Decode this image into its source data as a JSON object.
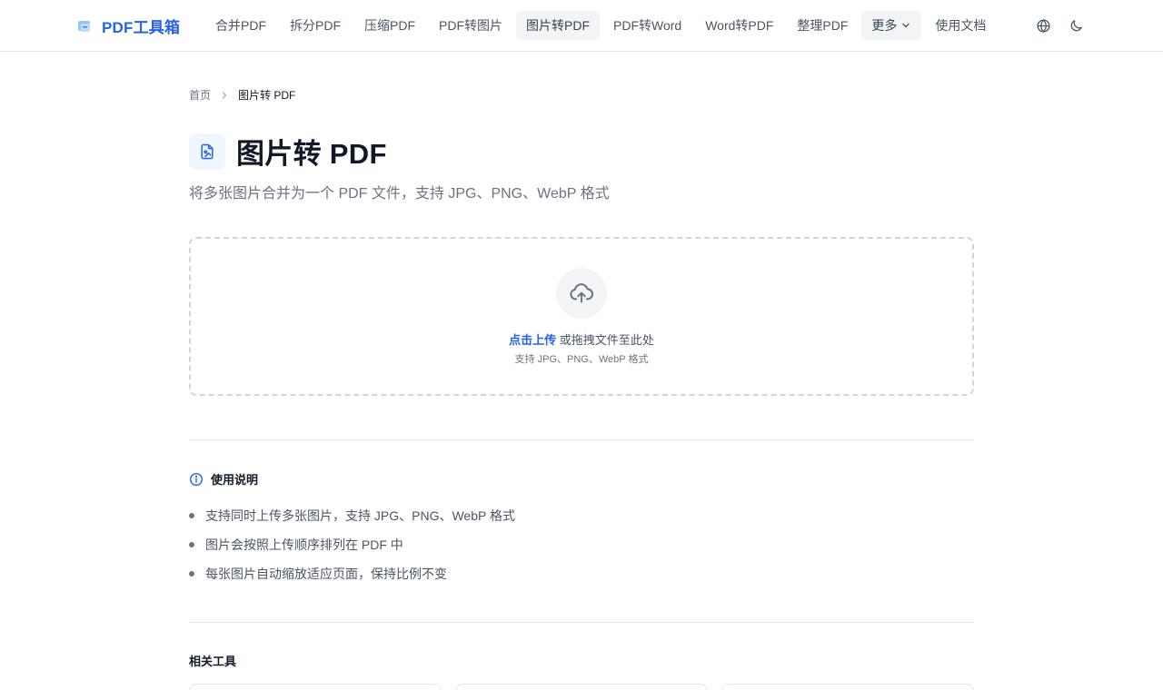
{
  "header": {
    "brand_name": "PDF工具箱",
    "nav": [
      {
        "label": "合并PDF",
        "active": false
      },
      {
        "label": "拆分PDF",
        "active": false
      },
      {
        "label": "压缩PDF",
        "active": false
      },
      {
        "label": "PDF转图片",
        "active": false
      },
      {
        "label": "图片转PDF",
        "active": true
      },
      {
        "label": "PDF转Word",
        "active": false
      },
      {
        "label": "Word转PDF",
        "active": false
      },
      {
        "label": "整理PDF",
        "active": false
      }
    ],
    "more_label": "更多",
    "docs_label": "使用文档",
    "icons": [
      "globe-icon",
      "moon-icon"
    ]
  },
  "breadcrumb": {
    "home": "首页",
    "current": "图片转 PDF"
  },
  "page": {
    "title": "图片转 PDF",
    "subtitle": "将多张图片合并为一个 PDF 文件，支持 JPG、PNG、WebP 格式"
  },
  "upload": {
    "link_text": "点击上传",
    "rest_text": " 或拖拽文件至此处",
    "hint": "支持 JPG、PNG、WebP 格式"
  },
  "instructions": {
    "title": "使用说明",
    "items": [
      "支持同时上传多张图片，支持 JPG、PNG、WebP 格式",
      "图片会按照上传顺序排列在 PDF 中",
      "每张图片自动缩放适应页面，保持比例不变"
    ]
  },
  "related": {
    "title": "相关工具"
  },
  "colors": {
    "accent": "#2563eb",
    "muted_text": "#6b7280",
    "border": "#e5e7eb"
  }
}
